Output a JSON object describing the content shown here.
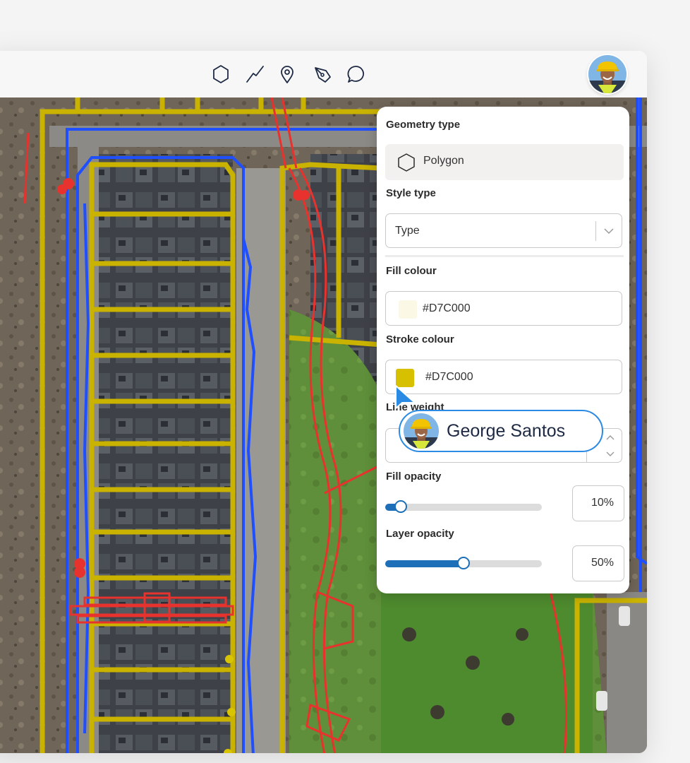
{
  "toolbar": {
    "tools": [
      {
        "icon": "polygon-icon"
      },
      {
        "icon": "line-icon"
      },
      {
        "icon": "map-pin-icon"
      },
      {
        "icon": "pen-icon"
      },
      {
        "icon": "comment-icon"
      }
    ],
    "avatar": "worker-avatar"
  },
  "panel": {
    "geometry_label": "Geometry type",
    "geometry_value": "Polygon",
    "style_label": "Style type",
    "style_placeholder": "Type",
    "fill_label": "Fill colour",
    "fill_value": "#D7C000",
    "fill_swatch_color": "#fbf8e6",
    "stroke_label": "Stroke colour",
    "stroke_value": "#D7C000",
    "stroke_swatch_color": "#D7C000",
    "line_weight_label": "Line weight",
    "fill_opacity_label": "Fill opacity",
    "fill_opacity_value": "10%",
    "fill_opacity_fraction": 0.1,
    "layer_opacity_label": "Layer opacity",
    "layer_opacity_value": "50%",
    "layer_opacity_fraction": 0.5
  },
  "collaborator": {
    "name": "George Santos"
  },
  "colors": {
    "accent": "#1d6fb8",
    "chip_border": "#2b8ae3",
    "parcel_yellow": "#c9b200",
    "pipe_blue": "#1f4fff",
    "boundary_red": "#e8322e"
  }
}
